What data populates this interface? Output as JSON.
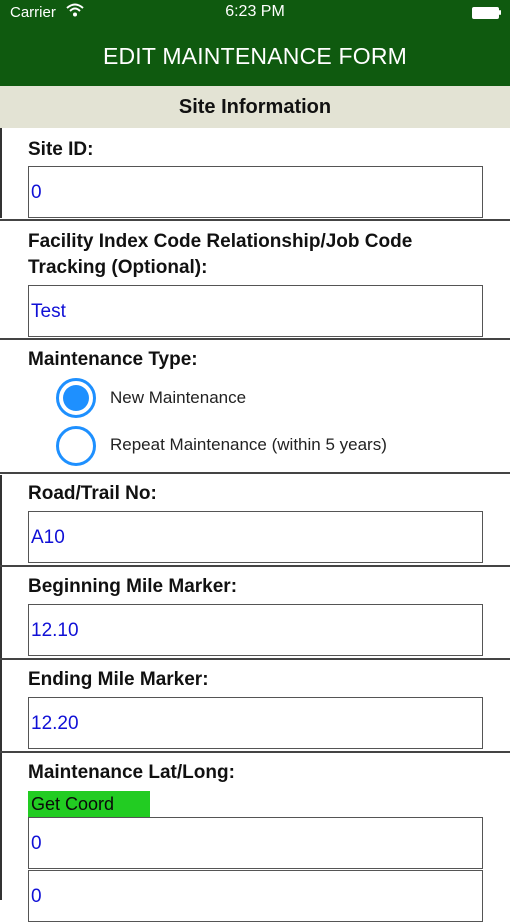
{
  "status_bar": {
    "carrier": "Carrier",
    "time": "6:23 PM",
    "wifi_icon": "wifi-icon",
    "battery_icon": "battery-icon"
  },
  "header": {
    "title": "EDIT MAINTENANCE FORM",
    "background": "#0f5a0f"
  },
  "section": {
    "title": "Site Information",
    "background": "#e3e3d4"
  },
  "fields": {
    "site_id": {
      "label": "Site ID:",
      "value": "0"
    },
    "facility_code": {
      "label_line1": "Facility Index Code Relationship/Job Code",
      "label_line2": "Tracking (Optional):",
      "value": "Test"
    },
    "maintenance_type": {
      "label": "Maintenance Type:",
      "options": [
        {
          "label": "New Maintenance",
          "selected": true
        },
        {
          "label": "Repeat Maintenance (within 5 years)",
          "selected": false
        }
      ]
    },
    "road_trail": {
      "label": "Road/Trail No:",
      "value": "A10"
    },
    "begin_mile": {
      "label": "Beginning Mile Marker:",
      "value": "12.10"
    },
    "end_mile": {
      "label": "Ending Mile Marker:",
      "value": "12.20"
    },
    "lat_long": {
      "label": "Maintenance Lat/Long:",
      "button_label": "Get Coord",
      "button_color": "#22cc22",
      "lat_value": "0",
      "long_value": "0"
    }
  },
  "colors": {
    "input_text": "#1010d6",
    "radio_accent": "#1e90ff"
  }
}
